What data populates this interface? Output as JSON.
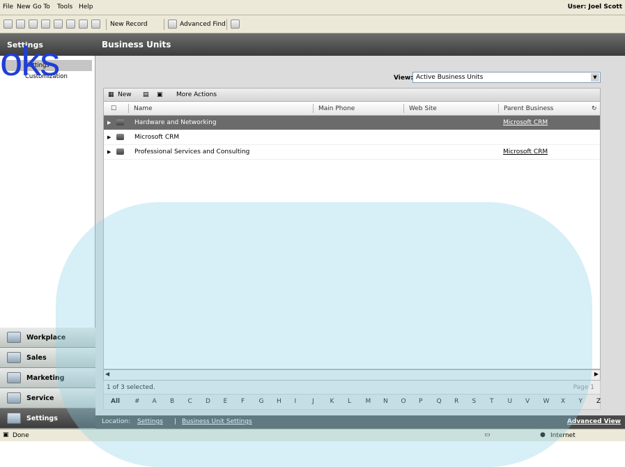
{
  "menu": {
    "items": [
      "File",
      "New",
      "Go To",
      "Tools",
      "Help"
    ],
    "user": "User: Joel Scott"
  },
  "toolbar": {
    "new_record": "New Record",
    "advanced_find": "Advanced Find"
  },
  "left": {
    "header": "Settings",
    "items": [
      "Settings",
      "Customization"
    ]
  },
  "main": {
    "title": "Business Units",
    "view_label": "View:",
    "view_value": "Active Business Units"
  },
  "grid": {
    "toolbar": {
      "new": "New",
      "more_actions": "More Actions"
    },
    "columns": [
      "Name",
      "Main Phone",
      "Web Site",
      "Parent Business"
    ],
    "rows": [
      {
        "name": "Hardware and Networking",
        "phone": "",
        "site": "",
        "parent": "Microsoft CRM",
        "selected": true
      },
      {
        "name": "Microsoft CRM",
        "phone": "",
        "site": "",
        "parent": "",
        "selected": false
      },
      {
        "name": "Professional Services and Consulting",
        "phone": "",
        "site": "",
        "parent": "Microsoft CRM",
        "selected": false
      }
    ],
    "status": "1 of 3 selected.",
    "page": "Page 1",
    "alphabet": [
      "All",
      "#",
      "A",
      "B",
      "C",
      "D",
      "E",
      "F",
      "G",
      "H",
      "I",
      "J",
      "K",
      "L",
      "M",
      "N",
      "O",
      "P",
      "Q",
      "R",
      "S",
      "T",
      "U",
      "V",
      "W",
      "X",
      "Y",
      "Z"
    ]
  },
  "nav": {
    "buttons": [
      "Workplace",
      "Sales",
      "Marketing",
      "Service",
      "Settings"
    ],
    "active": "Settings"
  },
  "location": {
    "label": "Location:",
    "crumbs": [
      "Settings",
      "Business Unit Settings"
    ],
    "advanced_view": "Advanced View"
  },
  "statusbar": {
    "left": "Done",
    "right": "Internet"
  },
  "watermark": {
    "text": "oks"
  },
  "colors": {
    "header_dark": "#3c3c3c",
    "selected_row": "#6b6b6b",
    "link_blue": "#1f3ed6"
  }
}
